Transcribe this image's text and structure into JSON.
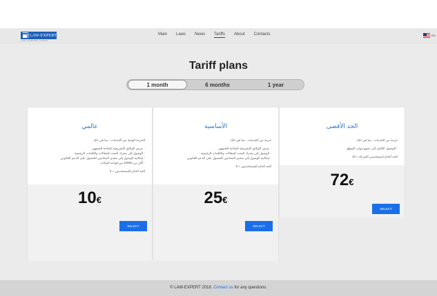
{
  "brand": {
    "name": "LAW-EXPERT",
    "tagline": "LAW LEARNING SAGES",
    "logo_icon": "building-icon"
  },
  "nav": {
    "items": [
      "Main",
      "Laws",
      "News",
      "Tariffs",
      "About",
      "Contacts"
    ],
    "active": "Tariffs"
  },
  "language": {
    "label": "EN",
    "icon": "us-flag-icon"
  },
  "page": {
    "title": "Tariff plans"
  },
  "periods": {
    "options": [
      "1 month",
      "6 months",
      "1 year"
    ],
    "selected": "1 month"
  },
  "plans": [
    {
      "name": "عالمي",
      "intro": "الحزمة الوثنية من الخدمات ، بما في ذلك:",
      "features": [
        "عرض الوثائق التشريعية المتاحة للجمهور",
        "الوصول إلى محرك البحث للمقالات والكلمات الرئيسية",
        "إمكانية الوصول إلى منتدى المحامين للحصول على الدعم القانوني",
        "أكثر من 10000 من قواعد البيانات"
      ],
      "limit": "الحد الحاح للمستخدمين = 2",
      "price": "10",
      "currency": "€",
      "button": "SELECT"
    },
    {
      "name": "الأساسية",
      "intro": "حزمة من الخدمات ، بما في ذلك:",
      "features": [
        "عرض الوثائق التشريعية المتاحة للجمهور",
        "الوصول إلى محرك البحث للمقالات والكلمات الرئيسية",
        "إمكانية الوصول إلى منتدى المحامين للحصول على الدعم القانوني"
      ],
      "limit": "الحد الحاح للمستخدمين = 5",
      "price": "25",
      "currency": "€",
      "button": "SELECT"
    },
    {
      "name": "الحد الأقصى",
      "intro": "حزمة من الخدمات ، بما في ذلك:",
      "features": [
        "الوصول الكامل إلى جميع موارد الموقع"
      ],
      "limit": "الحد الحاح لمستخدمي الشركة = 10",
      "price": "72",
      "currency": "€",
      "button": "SELECT"
    }
  ],
  "footer": {
    "copyright": "© LAW-EXPERT 2018.",
    "link": "Contact us",
    "suffix": "for any questions."
  },
  "colors": {
    "accent": "#1a6fe8",
    "plan_title": "#2b73c5",
    "background": "#ebebeb",
    "footer": "#d4d4d4"
  }
}
